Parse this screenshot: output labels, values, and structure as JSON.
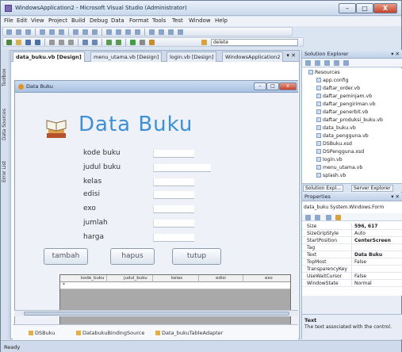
{
  "window": {
    "title": "WindowsApplication2 - Microsoft Visual Studio (Administrator)",
    "controls": {
      "minimize": "–",
      "maximize": "□",
      "close": "X"
    }
  },
  "menu": [
    "File",
    "Edit",
    "View",
    "Project",
    "Build",
    "Debug",
    "Data",
    "Format",
    "Tools",
    "Test",
    "Window",
    "Help"
  ],
  "toolbar": {
    "config_combo": "delete"
  },
  "left_strip_tabs": [
    "Toolbox",
    "Data Sources",
    "Error List"
  ],
  "doc_tabs": [
    "data_buku.vb [Design]",
    "menu_utama.vb [Design]",
    "login.vb [Design]",
    "WindowsApplication2"
  ],
  "doc_controls": "▾ ✕",
  "form": {
    "title": "Data Buku",
    "heading": "Data Buku",
    "fields": [
      {
        "label": "kode buku"
      },
      {
        "label": "judul buku"
      },
      {
        "label": "kelas"
      },
      {
        "label": "edisi"
      },
      {
        "label": "exo"
      },
      {
        "label": "jumlah"
      },
      {
        "label": "harga"
      }
    ],
    "buttons": {
      "save": "tambah",
      "delete": "hapus",
      "close": "tutup"
    },
    "grid": {
      "columns": [
        "kode_buku",
        "judul_buku",
        "kelas",
        "edisi",
        "exo"
      ],
      "new_row_marker": "*"
    }
  },
  "component_tray": [
    "DSBuku",
    "DatabukuBindingSource",
    "Data_bukuTableAdapter"
  ],
  "solution_explorer": {
    "title": "Solution Explorer",
    "items": [
      "Resources",
      "app.config",
      "daftar_order.vb",
      "daftar_peminjam.vb",
      "daftar_pengiriman.vb",
      "daftar_penerbit.vb",
      "daftar_produksi_buku.vb",
      "data_buku.vb",
      "data_pengguna.vb",
      "DSBuku.xsd",
      "DSPengguna.xsd",
      "login.vb",
      "menu_utama.vb",
      "splash.vb"
    ]
  },
  "bottom_tabs": [
    "Solution Expl...",
    "Server Explorer"
  ],
  "properties": {
    "title": "Properties",
    "selected": "data_buku System.Windows.Form",
    "rows": [
      {
        "name": "Size",
        "value": "596, 617",
        "bold": true
      },
      {
        "name": "SizeGripStyle",
        "value": "Auto"
      },
      {
        "name": "StartPosition",
        "value": "CenterScreen",
        "bold": true
      },
      {
        "name": "Tag",
        "value": ""
      },
      {
        "name": "Text",
        "value": "Data Buku",
        "bold": true
      },
      {
        "name": "TopMost",
        "value": "False"
      },
      {
        "name": "TransparencyKey",
        "value": ""
      },
      {
        "name": "UseWaitCursor",
        "value": "False"
      },
      {
        "name": "WindowState",
        "value": "Normal"
      }
    ],
    "desc_title": "Text",
    "desc_text": "The text associated with the control."
  },
  "status": "Ready"
}
